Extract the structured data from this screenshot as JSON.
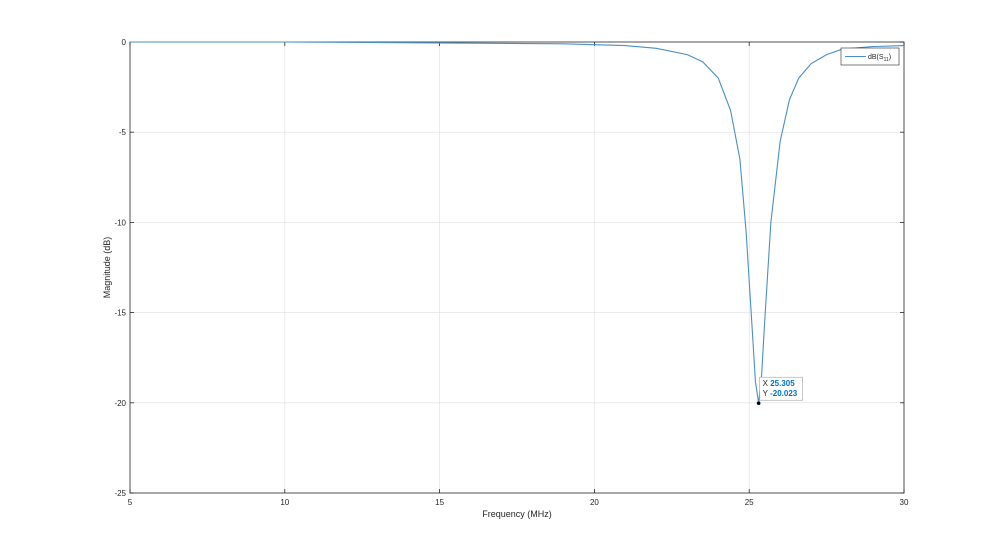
{
  "chart_data": {
    "type": "line",
    "title": "",
    "xlabel": "Frequency (MHz)",
    "ylabel": "Magnitude (dB)",
    "xlim": [
      5,
      30
    ],
    "ylim": [
      -25,
      0
    ],
    "x_ticks": [
      "5",
      "10",
      "15",
      "20",
      "25",
      "30"
    ],
    "y_ticks": [
      "0",
      "-5",
      "-10",
      "-15",
      "-20",
      "-25"
    ],
    "grid": true,
    "legend_position": "top-right",
    "series": [
      {
        "name": "dB(S11)",
        "name_main": "dB(S",
        "name_sub": "11",
        "name_close": ")",
        "color": "#4a90c4",
        "x": [
          5,
          10,
          15,
          19,
          21,
          22,
          23,
          23.5,
          24,
          24.4,
          24.7,
          24.9,
          25.1,
          25.2,
          25.305,
          25.4,
          25.5,
          25.7,
          26,
          26.3,
          26.6,
          27,
          27.5,
          28,
          29,
          30
        ],
        "y": [
          0,
          0,
          -0.05,
          -0.1,
          -0.2,
          -0.35,
          -0.7,
          -1.1,
          -2.0,
          -3.8,
          -6.5,
          -10.5,
          -16.0,
          -18.8,
          -20.023,
          -18.5,
          -15.5,
          -10.0,
          -5.5,
          -3.2,
          -2.0,
          -1.2,
          -0.7,
          -0.4,
          -0.25,
          -0.2
        ]
      }
    ],
    "datatip": {
      "x_label": "X",
      "x_value": "25.305",
      "y_label": "Y",
      "y_value": "-20.023",
      "x": 25.305,
      "y": -20.023
    }
  }
}
